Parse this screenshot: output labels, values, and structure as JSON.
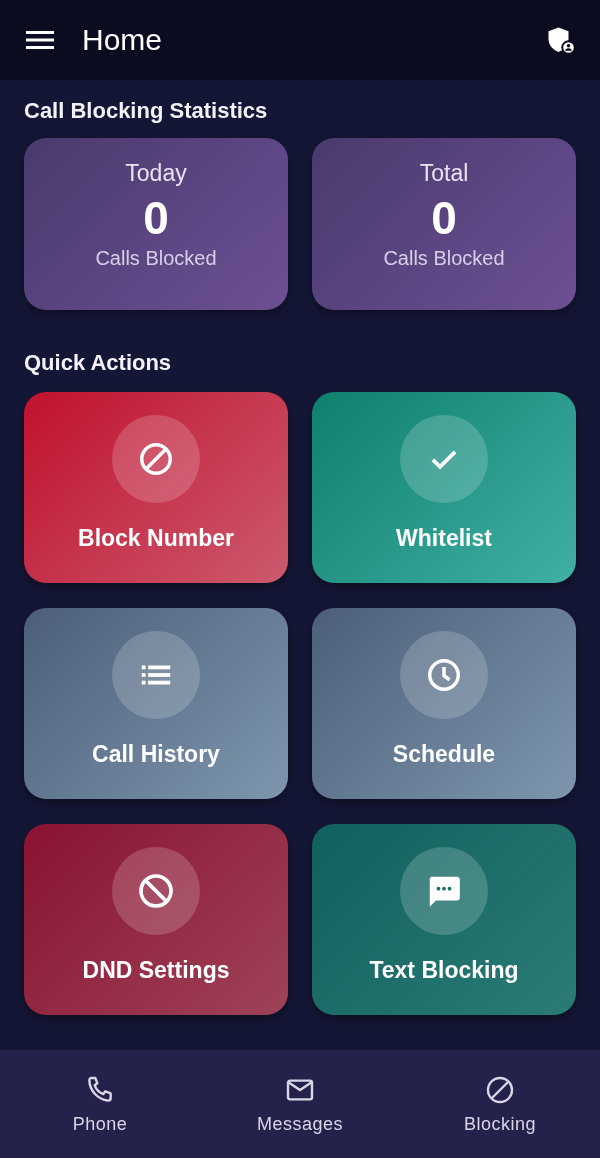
{
  "app_bar": {
    "title": "Home"
  },
  "statistics": {
    "heading": "Call Blocking Statistics",
    "cards": [
      {
        "period": "Today",
        "count": "0",
        "caption": "Calls Blocked"
      },
      {
        "period": "Total",
        "count": "0",
        "caption": "Calls Blocked"
      }
    ]
  },
  "quick_actions": {
    "heading": "Quick Actions",
    "items": [
      {
        "kind": "block",
        "label": "Block Number"
      },
      {
        "kind": "whitelist",
        "label": "Whitelist"
      },
      {
        "kind": "history",
        "label": "Call History"
      },
      {
        "kind": "schedule",
        "label": "Schedule"
      },
      {
        "kind": "dnd",
        "label": "DND Settings"
      },
      {
        "kind": "text",
        "label": "Text Blocking"
      }
    ]
  },
  "bottom_nav": [
    {
      "kind": "phone",
      "label": "Phone"
    },
    {
      "kind": "messages",
      "label": "Messages"
    },
    {
      "kind": "blocking",
      "label": "Blocking"
    }
  ]
}
